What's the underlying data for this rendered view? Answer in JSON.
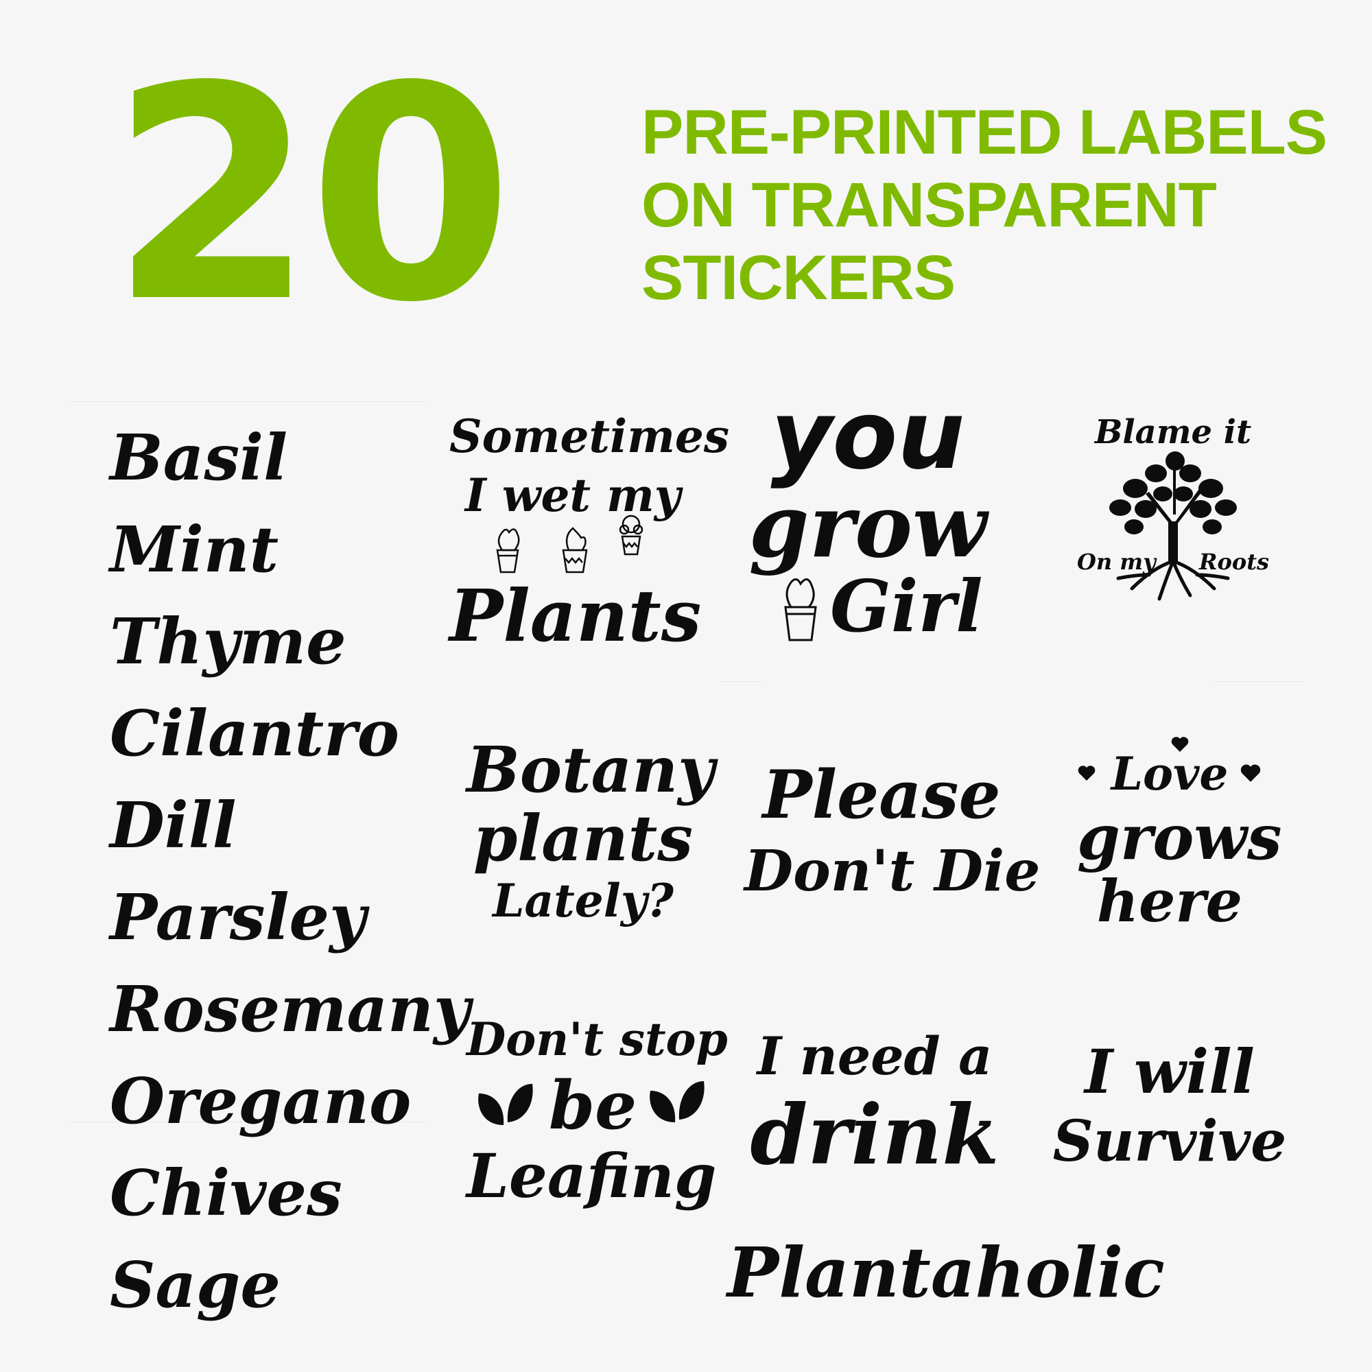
{
  "header": {
    "count": "20",
    "lines": [
      "PRE-PRINTED LABELS",
      "ON TRANSPARENT",
      "STICKERS"
    ]
  },
  "herbs": [
    "Basil",
    "Mint",
    "Thyme",
    "Cilantro",
    "Dill",
    "Parsley",
    "Rosemany",
    "Oregano",
    "Chives",
    "Sage"
  ],
  "stickers": {
    "wet_plants": [
      "Sometimes",
      "I wet my",
      "Plants"
    ],
    "you_grow_girl": [
      "you",
      "grow",
      "Girl"
    ],
    "blame_roots": {
      "top": "Blame it",
      "left": "On my",
      "right": "Roots"
    },
    "botany": [
      "Botany",
      "plants",
      "Lately?"
    ],
    "please_dont_die": [
      "Please",
      "Don't Die"
    ],
    "love_grows": [
      "Love",
      "grows",
      "here"
    ],
    "dont_stop": [
      "Don't stop",
      "be",
      "Leafing"
    ],
    "need_drink": [
      "I need a",
      "drink"
    ],
    "will_survive": [
      "I will",
      "Survive"
    ],
    "plantaholic": "Plantaholic"
  },
  "colors": {
    "accent": "#7fba00",
    "ink": "#0d0d0d",
    "background": "#f6f6f6"
  },
  "icons": [
    "potted-cactus-icon",
    "tree-with-roots-icon",
    "heart-icon",
    "leaf-icon"
  ]
}
